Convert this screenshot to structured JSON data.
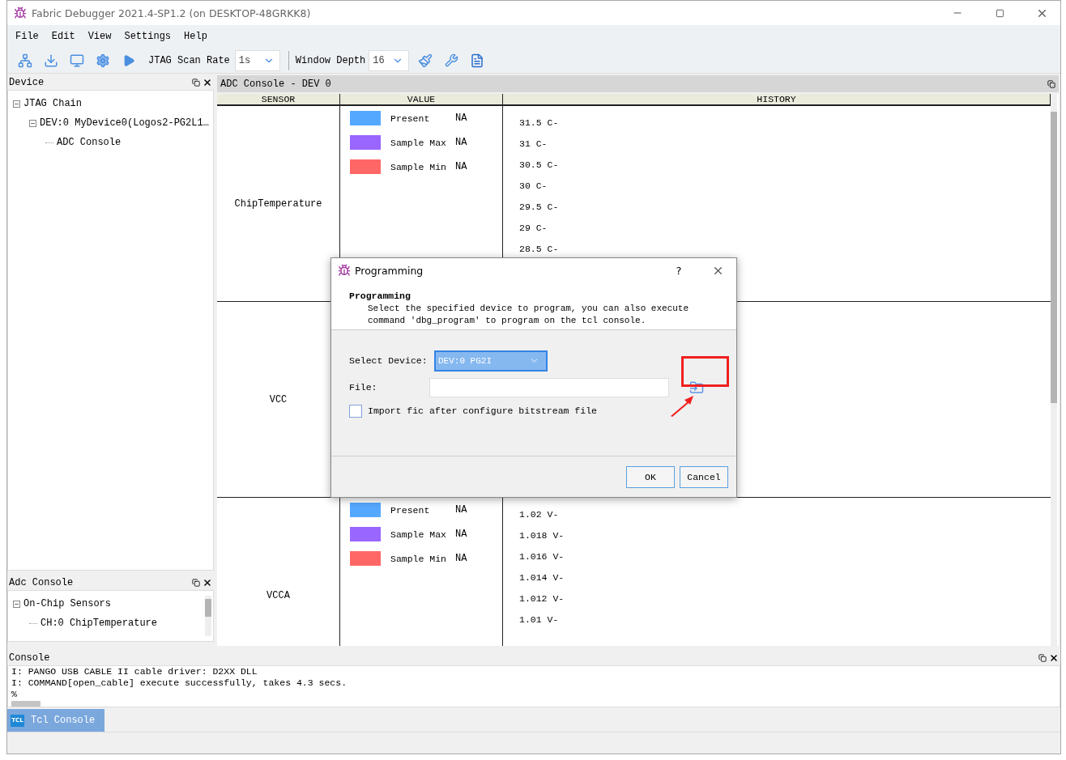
{
  "window": {
    "title": "Fabric Debugger 2021.4-SP1.2 (on DESKTOP-48GRKK8)"
  },
  "menu": [
    "File",
    "Edit",
    "View",
    "Settings",
    "Help"
  ],
  "toolbar": {
    "scan_rate": {
      "label": "JTAG Scan Rate",
      "value": "1s"
    },
    "window_depth": {
      "label": "Window Depth",
      "value": "16"
    }
  },
  "device_panel": {
    "title": "Device",
    "tree": [
      {
        "label": "JTAG Chain",
        "expanded": true,
        "children": [
          {
            "label": "DEV:0 MyDevice0(Logos2-PG2L1…",
            "expanded": true,
            "children": [
              {
                "label": "ADC Console"
              }
            ]
          }
        ]
      }
    ]
  },
  "adc_panel": {
    "title": "Adc Console",
    "tree": [
      {
        "label": "On-Chip Sensors",
        "expanded": true,
        "children": [
          {
            "label": "CH:0 ChipTemperature"
          }
        ]
      }
    ]
  },
  "adc_console": {
    "title": "ADC Console - DEV 0",
    "columns": [
      "SENSOR",
      "VALUE",
      "HISTORY"
    ],
    "rows": [
      {
        "sensor": "ChipTemperature",
        "values": [
          {
            "label": "Present",
            "value": "NA",
            "color": "#55a8ff"
          },
          {
            "label": "Sample Max",
            "value": "NA",
            "color": "#9966ff"
          },
          {
            "label": "Sample Min",
            "value": "NA",
            "color": "#ff6666"
          }
        ],
        "history": [
          "31.5 C-",
          "31 C-",
          "30.5 C-",
          "30 C-",
          "29.5 C-",
          "29 C-",
          "28.5 C-"
        ]
      },
      {
        "sensor": "VCC",
        "values": [],
        "history": []
      },
      {
        "sensor": "VCCA",
        "values": [
          {
            "label": "Present",
            "value": "NA",
            "color": "#55a8ff"
          },
          {
            "label": "Sample Max",
            "value": "NA",
            "color": "#9966ff"
          },
          {
            "label": "Sample Min",
            "value": "NA",
            "color": "#ff6666"
          }
        ],
        "history": [
          "1.02 V-",
          "1.018 V-",
          "1.016 V-",
          "1.014 V-",
          "1.012 V-",
          "1.01 V-"
        ]
      }
    ]
  },
  "console": {
    "title": "Console",
    "lines": [
      "I: PANGO USB CABLE II cable driver: D2XX DLL",
      "I: COMMAND[open_cable] execute successfully, takes 4.3 secs.",
      "%"
    ]
  },
  "bottom_tabs": [
    {
      "label": "Tcl Console",
      "icon_text": "TCL",
      "selected": true
    }
  ],
  "dialog": {
    "title": "Programming",
    "help": "?",
    "heading": "Programming",
    "description": "Select the specified device to program, you can also execute command 'dbg_program' to program on the tcl console.",
    "device_label": "Select Device:",
    "device_value": "DEV:0 PG2I",
    "file_label": "File:",
    "import_checkbox": {
      "label": "Import fic after configure bitstream file",
      "checked": false
    },
    "buttons": [
      "OK",
      "Cancel"
    ]
  }
}
